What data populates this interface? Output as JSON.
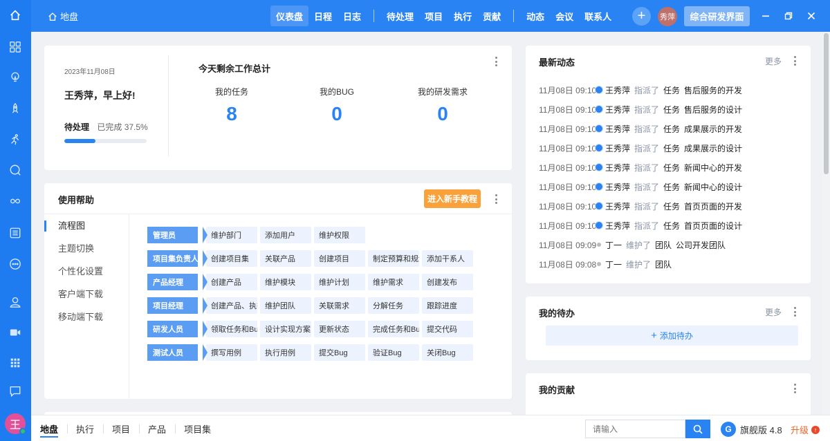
{
  "rail": {
    "icons": [
      "home-icon",
      "grid-icon",
      "lightbulb-icon",
      "rocket-icon",
      "runner-icon",
      "bug-search-icon",
      "infinity-icon",
      "list-icon",
      "more-circle-icon",
      "user-icon",
      "video-icon",
      "apps-icon",
      "chat-icon"
    ],
    "avatar_letter": "王"
  },
  "topbar": {
    "breadcrumb": "地盘",
    "nav": [
      "仪表盘",
      "日程",
      "日志",
      "待处理",
      "项目",
      "执行",
      "贡献",
      "动态",
      "会议",
      "联系人"
    ],
    "active_nav": "仪表盘",
    "avatar_text": "秀萍",
    "switch_button": "综合研发界面"
  },
  "welcome": {
    "date": "2023年11月08日",
    "greeting": "王秀萍，早上好!",
    "pending_label": "待处理",
    "completed_text": "已完成 37.5%",
    "progress": 0.375
  },
  "stats": {
    "title": "今天剩余工作总计",
    "items": [
      {
        "label": "我的任务",
        "value": "8"
      },
      {
        "label": "我的BUG",
        "value": "0"
      },
      {
        "label": "我的研发需求",
        "value": "0"
      }
    ]
  },
  "help": {
    "title": "使用帮助",
    "tutorial_button": "进入新手教程",
    "menu": [
      "流程图",
      "主题切换",
      "个性化设置",
      "客户端下载",
      "移动端下载"
    ],
    "flows": [
      {
        "role": "管理员",
        "steps": [
          "维护部门",
          "添加用户",
          "维护权限"
        ]
      },
      {
        "role": "项目集负责人",
        "steps": [
          "创建项目集",
          "关联产品",
          "创建项目",
          "制定预算和规划",
          "添加干系人"
        ]
      },
      {
        "role": "产品经理",
        "steps": [
          "创建产品",
          "维护模块",
          "维护计划",
          "维护需求",
          "创建发布"
        ]
      },
      {
        "role": "项目经理",
        "steps": [
          "创建产品、执行",
          "维护团队",
          "关联需求",
          "分解任务",
          "跟踪进度"
        ]
      },
      {
        "role": "研发人员",
        "steps": [
          "领取任务和Bug",
          "设计实现方案",
          "更新状态",
          "完成任务和Bug",
          "提交代码"
        ]
      },
      {
        "role": "测试人员",
        "steps": [
          "撰写用例",
          "执行用例",
          "提交Bug",
          "验证Bug",
          "关闭Bug"
        ]
      }
    ]
  },
  "activity": {
    "title": "最新动态",
    "more": "更多",
    "items": [
      {
        "time": "11月08日 09:10",
        "who": "王秀萍",
        "verb": "指派了",
        "type": "任务",
        "name": "售后服务的开发",
        "dot": "blue"
      },
      {
        "time": "11月08日 09:10",
        "who": "王秀萍",
        "verb": "指派了",
        "type": "任务",
        "name": "售后服务的设计",
        "dot": "blue"
      },
      {
        "time": "11月08日 09:10",
        "who": "王秀萍",
        "verb": "指派了",
        "type": "任务",
        "name": "成果展示的开发",
        "dot": "blue"
      },
      {
        "time": "11月08日 09:10",
        "who": "王秀萍",
        "verb": "指派了",
        "type": "任务",
        "name": "成果展示的设计",
        "dot": "blue"
      },
      {
        "time": "11月08日 09:10",
        "who": "王秀萍",
        "verb": "指派了",
        "type": "任务",
        "name": "新闻中心的开发",
        "dot": "blue"
      },
      {
        "time": "11月08日 09:10",
        "who": "王秀萍",
        "verb": "指派了",
        "type": "任务",
        "name": "新闻中心的设计",
        "dot": "blue"
      },
      {
        "time": "11月08日 09:10",
        "who": "王秀萍",
        "verb": "指派了",
        "type": "任务",
        "name": "首页页面的开发",
        "dot": "blue"
      },
      {
        "time": "11月08日 09:10",
        "who": "王秀萍",
        "verb": "指派了",
        "type": "任务",
        "name": "首页页面的设计",
        "dot": "blue"
      },
      {
        "time": "11月08日 09:09",
        "who": "丁一",
        "verb": "维护了",
        "type": "团队",
        "name": "公司开发团队",
        "dot": "gray"
      },
      {
        "time": "11月08日 09:08",
        "who": "丁一",
        "verb": "维护了",
        "type": "团队",
        "name": "",
        "dot": "gray"
      }
    ]
  },
  "todo": {
    "title": "我的待办",
    "more": "更多",
    "add_label": "添加待办"
  },
  "contrib": {
    "title": "我的贡献"
  },
  "bottombar": {
    "tabs": [
      "地盘",
      "执行",
      "项目",
      "产品",
      "项目集"
    ],
    "active_tab": "地盘",
    "search_placeholder": "请输入",
    "edition": "旗舰版 4.8",
    "upgrade": "升级"
  },
  "colors": {
    "primary": "#2a83f3",
    "rail": "#1f7cf0",
    "orange": "#f9a23c",
    "role_tag": "#5b9df2",
    "step_bg": "#ecf3fe"
  }
}
